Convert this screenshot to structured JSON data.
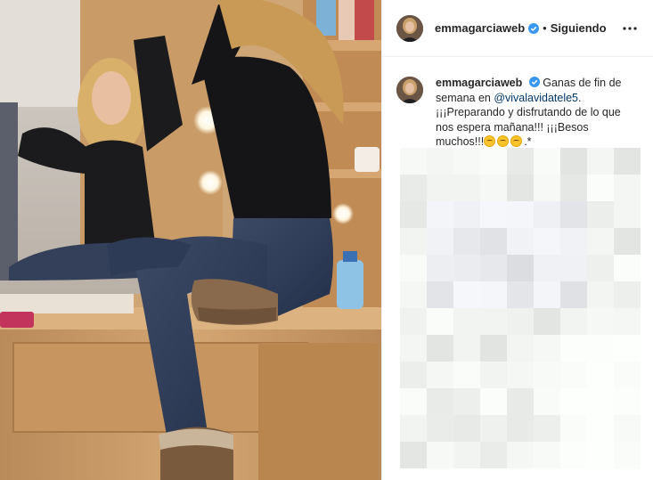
{
  "post": {
    "username": "emmagarciaweb",
    "verified": true,
    "follow_status": "Siguiendo",
    "more_icon": "more-options-icon"
  },
  "caption": {
    "username": "emmagarciaweb",
    "text_part1": "Ganas de fin de semana en ",
    "mention": "@vivalavidatele5",
    "text_part2": ". ¡¡¡Preparando y disfrutando de lo que nos espera mañana!!! ¡¡¡Besos muchos!!!",
    "text_part3": ".*",
    "emoji": "kissing-face-emoji",
    "emoji_count": 3
  },
  "colors": {
    "verified_blue": "#3897f0",
    "mention_blue": "#00376b",
    "text": "#262626",
    "border": "#efefef"
  }
}
